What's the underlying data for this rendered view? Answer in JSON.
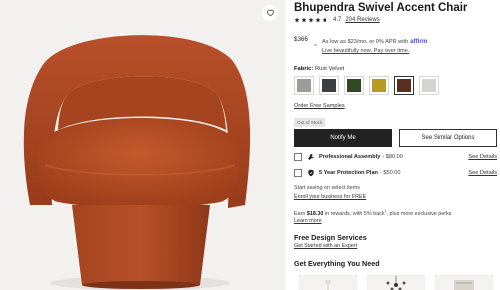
{
  "product": {
    "title": "Bhupendra Swivel Accent Chair",
    "rating": "4.7",
    "reviews": "204 Reviews",
    "price": "$366",
    "or_label": "or",
    "affirm_text": "As low as $23/mo, or 0% APR with",
    "affirm_brand": "affirm",
    "affirm_link": "Live beautifully now. Pay over time.",
    "fabric_prefix": "Fabric:",
    "fabric_value": "Rust Velvet",
    "swatches": [
      {
        "color": "#9d9c98"
      },
      {
        "color": "#3b3f41"
      },
      {
        "color": "#2f4a22"
      },
      {
        "color": "#b89a22"
      },
      {
        "color": "#5a2e20"
      },
      {
        "color": "#d4d4d2"
      }
    ],
    "samples_link": "Order Free Samples",
    "stock_status": "Out of Stock",
    "notify_label": "Notify Me",
    "similar_label": "See Similar Options"
  },
  "protection": [
    {
      "name": "Professional Assembly",
      "price": "- $80.00",
      "details": "See Details",
      "icon": "wrench-icon"
    },
    {
      "name": "5 Year Protection Plan",
      "price": "- $50.00",
      "details": "See Details",
      "icon": "shield-icon"
    }
  ],
  "business": {
    "text": "Start saving on select items",
    "link": "Enroll your business for FREE"
  },
  "rewards": {
    "prefix": "Earn",
    "amount": "$18.30",
    "suffix": "in rewards, with 5% back",
    "sup": "1",
    "suffix2": ", plus more exclusive perks",
    "link": "Learn more"
  },
  "design": {
    "title": "Free Design Services",
    "link": "Get Started with an Expert"
  },
  "get_everything": {
    "title": "Get Everything You Need"
  },
  "colors": {
    "chair": "#b04a22",
    "primary_button": "#222222",
    "affirm": "#4a4af4"
  }
}
